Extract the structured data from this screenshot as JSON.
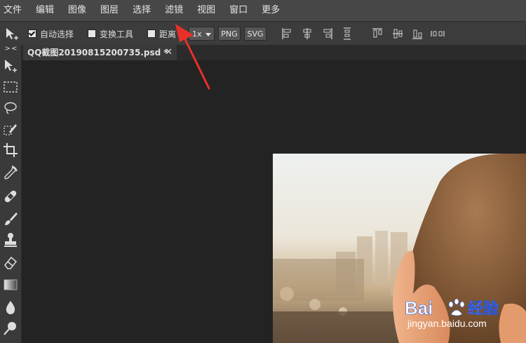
{
  "menu": [
    "文件",
    "编辑",
    "图像",
    "图层",
    "选择",
    "滤镜",
    "视图",
    "窗口",
    "更多"
  ],
  "options": {
    "auto_select_label": "自动选择",
    "auto_select_checked": true,
    "transform_label": "变换工具",
    "transform_checked": false,
    "distance_label": "距离",
    "distance_checked": false,
    "zoom_value": "1x",
    "png_label": "PNG",
    "svg_label": "SVG"
  },
  "toolbox": {
    "collapse_label": "> <",
    "tools": [
      "move-tool-icon",
      "marquee-tool-icon",
      "lasso-tool-icon",
      "quick-select-tool-icon",
      "crop-tool-icon",
      "eyedropper-tool-icon",
      "healing-brush-tool-icon",
      "brush-tool-icon",
      "stamp-tool-icon",
      "eraser-tool-icon",
      "gradient-tool-icon",
      "blur-tool-icon",
      "dodge-tool-icon"
    ]
  },
  "document_tab": {
    "title": "QQ截图20190815200735.psd *",
    "close_glyph": "✕"
  },
  "watermark": {
    "brand": "Bai",
    "brand_suffix": "经验",
    "url": "jingyan.baidu.com"
  },
  "colors": {
    "menubar": "#474747",
    "optionbar": "#3c3c3c",
    "canvas": "#232323",
    "arrow": "#e8302a",
    "watermark_blue": "#2a57d6"
  }
}
